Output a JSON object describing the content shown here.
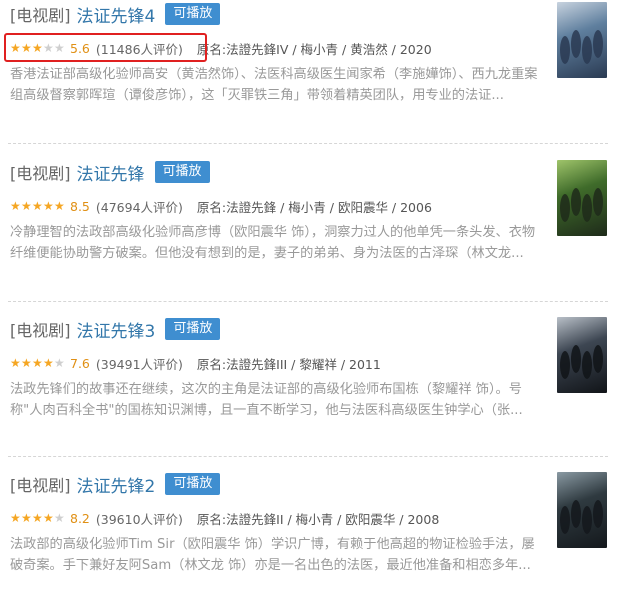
{
  "results": [
    {
      "category": "[电视剧]",
      "title": "法证先锋4",
      "badge": "可播放",
      "stars_filled": 3,
      "score": "5.6",
      "votes": "(11486人评价)",
      "meta": "原名:法證先鋒IV / 梅小青 / 黄浩然 / 2020",
      "desc": "香港法证部高级化验师高安（黄浩然饰）、法医科高级医生闻家希（李施嬅饰）、西九龙重案组高级督察郭晖瑄（谭俊彦饰），这「灭罪铁三角」带领着精英团队，用专业的法证...",
      "poster_colors": [
        "#2a3a52",
        "#5f7f9e",
        "#c8d3df"
      ]
    },
    {
      "category": "[电视剧]",
      "title": "法证先锋",
      "badge": "可播放",
      "stars_filled": 4.5,
      "score": "8.5",
      "votes": "(47694人评价)",
      "meta": "原名:法證先鋒 / 梅小青 / 欧阳震华 / 2006",
      "desc": "冷静理智的法政部高级化验师高彦博（欧阳震华 饰），洞察力过人的他单凭一条头发、衣物纤维便能协助警方破案。但他没有想到的是，妻子的弟弟、身为法医的古泽琛（林文龙...",
      "poster_colors": [
        "#1e2a1a",
        "#3f6b2a",
        "#9fc46a"
      ]
    },
    {
      "category": "[电视剧]",
      "title": "法证先锋3",
      "badge": "可播放",
      "stars_filled": 4,
      "score": "7.6",
      "votes": "(39491人评价)",
      "meta": "原名:法證先鋒III / 黎耀祥 / 2011",
      "desc": "法政先锋们的故事还在继续，这次的主角是法证部的高级化验师布国栋（黎耀祥 饰）。号称\"人肉百科全书\"的国栋知识渊博，且一直不断学习，他与法医科高级医生钟学心（张...",
      "poster_colors": [
        "#111418",
        "#3d4652",
        "#b9c0c8"
      ]
    },
    {
      "category": "[电视剧]",
      "title": "法证先锋2",
      "badge": "可播放",
      "stars_filled": 4,
      "score": "8.2",
      "votes": "(39610人评价)",
      "meta": "原名:法證先鋒II / 梅小青 / 欧阳震华 / 2008",
      "desc": "法政部的高级化验师Tim Sir（欧阳震华 饰）学识广博，有赖于他高超的物证检验手法，屡破奇案。手下兼好友阿Sam（林文龙 饰）亦是一名出色的法医，最近他准备和相恋多年...",
      "poster_colors": [
        "#14181c",
        "#2f3a40",
        "#8a9aa3"
      ]
    }
  ]
}
